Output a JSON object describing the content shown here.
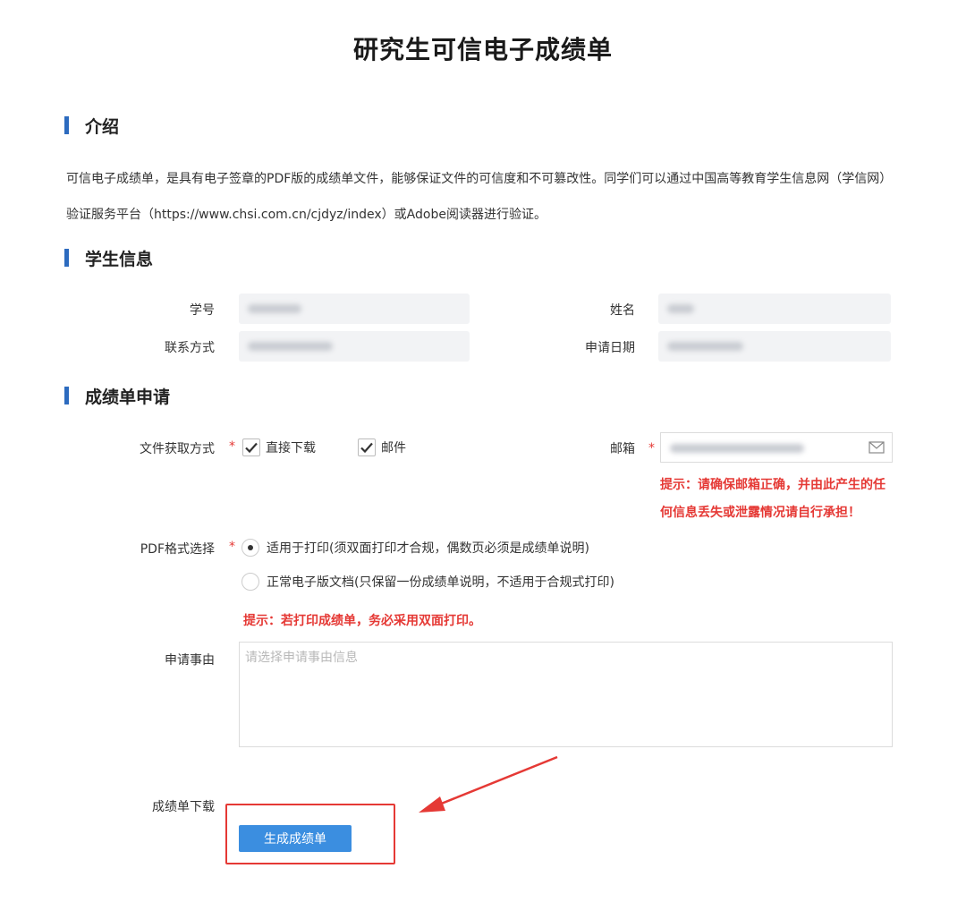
{
  "page_title": "研究生可信电子成绩单",
  "sections": {
    "intro": {
      "title": "介绍",
      "text": "可信电子成绩单，是具有电子签章的PDF版的成绩单文件，能够保证文件的可信度和不可篡改性。同学们可以通过中国高等教育学生信息网（学信网）验证服务平台（https://www.chsi.com.cn/cjdyz/index）或Adobe阅读器进行验证。"
    },
    "student_info": {
      "title": "学生信息",
      "fields": {
        "student_id": {
          "label": "学号",
          "value": ""
        },
        "name": {
          "label": "姓名",
          "value": ""
        },
        "contact": {
          "label": "联系方式",
          "value": ""
        },
        "apply_date": {
          "label": "申请日期",
          "value": ""
        }
      }
    },
    "application": {
      "title": "成绩单申请",
      "delivery": {
        "label": "文件获取方式",
        "required_mark": "*",
        "options": [
          {
            "label": "直接下载",
            "checked": true
          },
          {
            "label": "邮件",
            "checked": true
          }
        ]
      },
      "email": {
        "label": "邮箱",
        "required_mark": "*",
        "value": "",
        "icon": "mail-icon",
        "warning_line1": "提示：请确保邮箱正确，并由此产生的任",
        "warning_line2": "何信息丢失或泄露情况请自行承担！"
      },
      "pdf_format": {
        "label": "PDF格式选择",
        "required_mark": "*",
        "options": [
          {
            "label": "适用于打印(须双面打印才合规，偶数页必须是成绩单说明)",
            "selected": true
          },
          {
            "label": "正常电子版文档(只保留一份成绩单说明，不适用于合规式打印)",
            "selected": false
          }
        ],
        "warning": "提示：若打印成绩单，务必采用双面打印。"
      },
      "reason": {
        "label": "申请事由",
        "placeholder": "请选择申请事由信息",
        "value": ""
      },
      "download": {
        "label": "成绩单下载",
        "button_label": "生成成绩单"
      }
    }
  },
  "colors": {
    "accent_bar": "#2d6bbf",
    "warning_text": "#e53935",
    "button_bg": "#3b8ee0",
    "annotation_red": "#e53935"
  }
}
